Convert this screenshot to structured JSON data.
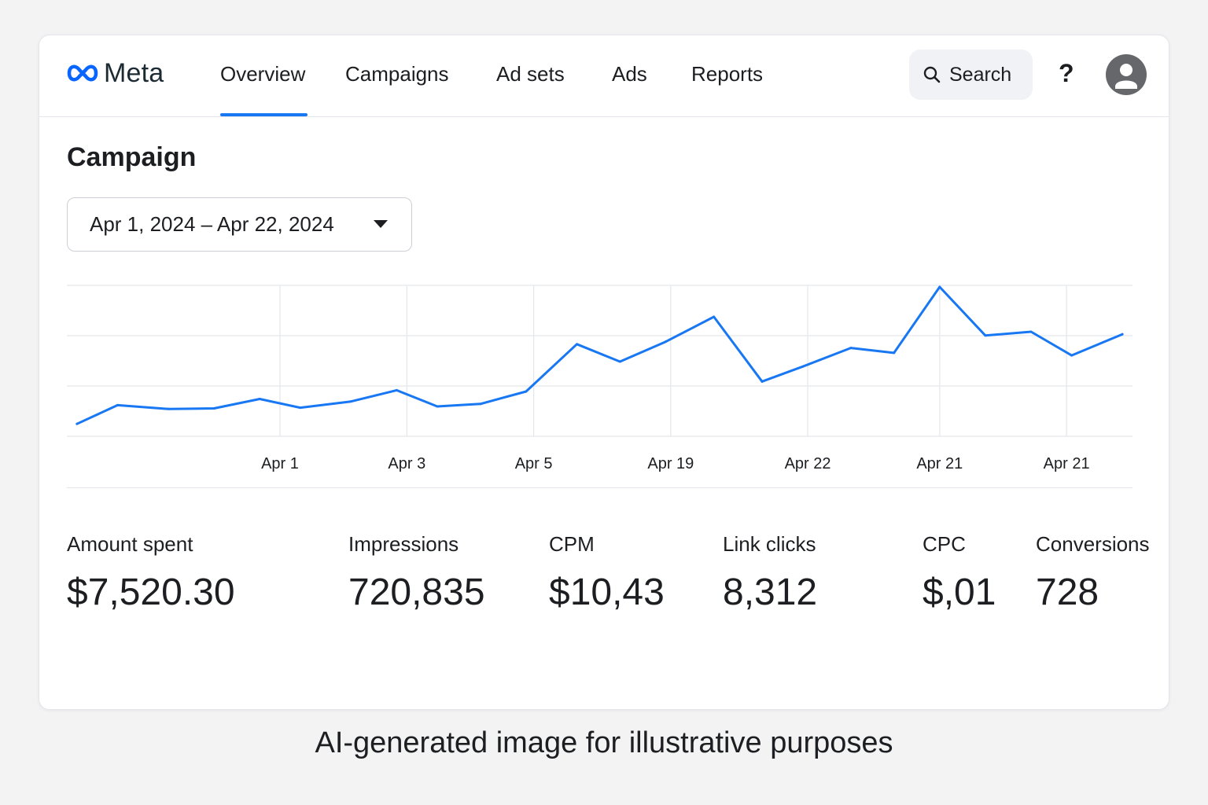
{
  "brand": {
    "name": "Meta",
    "logo_color": "#0866ff"
  },
  "nav": {
    "tabs": [
      {
        "label": "Overview",
        "active": true
      },
      {
        "label": "Campaigns",
        "active": false
      },
      {
        "label": "Ad sets",
        "active": false
      },
      {
        "label": "Ads",
        "active": false
      },
      {
        "label": "Reports",
        "active": false
      }
    ],
    "search_label": "Search",
    "help_symbol": "?",
    "icons": {
      "search": "search-icon",
      "help": "help-icon",
      "avatar": "user-avatar-icon"
    }
  },
  "page": {
    "title": "Campaign",
    "date_range": "Apr 1, 2024 – Apr 22, 2024"
  },
  "chart_data": {
    "type": "line",
    "x_tick_labels": [
      "Apr 1",
      "Apr 3",
      "Apr 5",
      "Apr 19",
      "Apr 22",
      "Apr 21",
      "Apr 21"
    ],
    "series": [
      {
        "color": "#1877f2",
        "values": [
          0.5,
          1.25,
          1.1,
          1.12,
          1.5,
          1.15,
          1.4,
          1.85,
          1.2,
          1.3,
          1.8,
          3.7,
          3.0,
          3.8,
          4.8,
          2.2,
          2.8,
          3.55,
          3.35,
          6.0,
          4.05,
          4.2,
          3.25,
          4.1
        ],
        "x_positions": [
          0.5,
          1.3,
          2.3,
          3.2,
          4.1,
          4.9,
          5.9,
          6.8,
          7.6,
          8.45,
          9.35,
          10.35,
          11.2,
          12.1,
          13.05,
          14.0,
          14.8,
          15.75,
          16.6,
          17.5,
          18.4,
          19.3,
          20.1,
          21.1
        ]
      }
    ],
    "x_tick_positions": [
      4.5,
      7.0,
      9.5,
      12.2,
      14.9,
      17.5,
      20.0
    ],
    "xlim": [
      0.3,
      21.3
    ],
    "ylim": [
      0,
      6
    ],
    "grid": true,
    "legend": "none"
  },
  "metrics": [
    {
      "label": "Amount spent",
      "value": "$7,520.30"
    },
    {
      "label": "Impressions",
      "value": "720,835"
    },
    {
      "label": "CPM",
      "value": "$10,43"
    },
    {
      "label": "Link clicks",
      "value": "8,312"
    },
    {
      "label": "CPC",
      "value": "$,01"
    },
    {
      "label": "Conversions",
      "value": "728"
    }
  ],
  "caption": "AI-generated image for illustrative purposes"
}
